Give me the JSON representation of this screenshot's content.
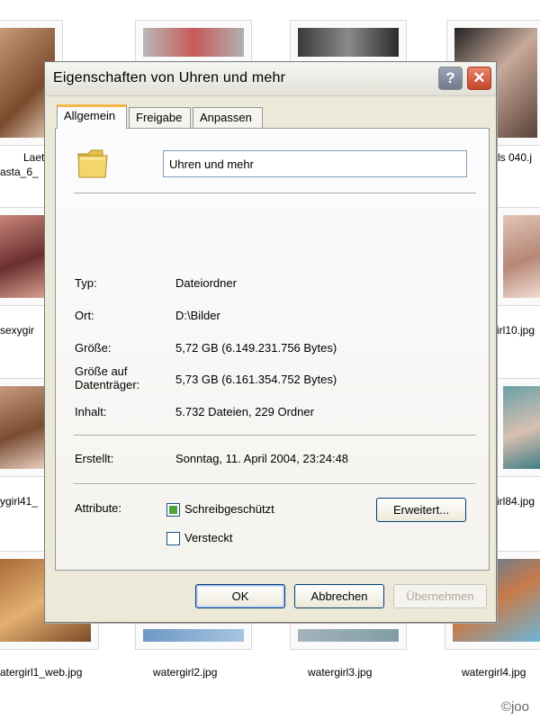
{
  "dialog": {
    "title": "Eigenschaften von Uhren und mehr",
    "help_glyph": "?",
    "close_glyph": "✕",
    "tabs": [
      {
        "label": "Allgemein",
        "active": true
      },
      {
        "label": "Freigabe",
        "active": false
      },
      {
        "label": "Anpassen",
        "active": false
      }
    ],
    "name_value": "Uhren und mehr",
    "fields": {
      "type_label": "Typ:",
      "type_value": "Dateiordner",
      "location_label": "Ort:",
      "location_value": "D:\\Bilder",
      "size_label": "Größe:",
      "size_value": "5,72 GB (6.149.231.756 Bytes)",
      "disk_size_label_1": "Größe auf",
      "disk_size_label_2": "Datenträger:",
      "disk_size_value": "5,73 GB (6.161.354.752 Bytes)",
      "contents_label": "Inhalt:",
      "contents_value": "5.732 Dateien, 229 Ordner",
      "created_label": "Erstellt:",
      "created_value": "Sonntag, 11. April 2004, 23:24:48"
    },
    "attributes": {
      "label": "Attribute:",
      "readonly_label": "Schreibgeschützt",
      "readonly_state": "mixed",
      "hidden_label": "Versteckt",
      "hidden_state": "unchecked",
      "advanced_label": "Erweitert..."
    },
    "buttons": {
      "ok": "OK",
      "cancel": "Abbrechen",
      "apply": "Übernehmen"
    }
  },
  "background": {
    "captions": [
      "Laet",
      "asta_6_",
      "ls 040.j",
      "sexygir",
      "irl10.jpg",
      "ygirl41_",
      "irl84.jpg",
      "atergirl1_web.jpg",
      "watergirl2.jpg",
      "watergirl3.jpg",
      "watergirl4.jpg"
    ],
    "watermark": "©joo"
  },
  "colors": {
    "dialog_face": "#ece9d8",
    "tab_accent": "#f7b64a",
    "close_button": "#c8462b",
    "checkbox_mixed": "#4ca33a"
  }
}
